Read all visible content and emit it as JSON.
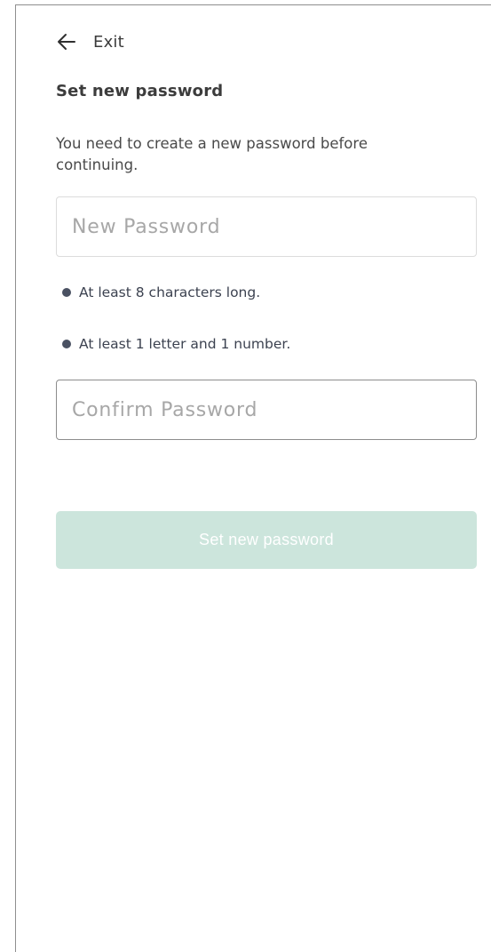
{
  "header": {
    "exit_label": "Exit",
    "back_icon": "arrow-left-icon"
  },
  "main": {
    "title": "Set new password",
    "description": "You need to create a new password before continuing.",
    "new_password": {
      "placeholder": "New Password",
      "value": ""
    },
    "requirements": [
      {
        "label": "At least 8 characters long."
      },
      {
        "label": "At least 1 letter and 1 number."
      }
    ],
    "confirm_password": {
      "placeholder": "Confirm Password",
      "value": ""
    },
    "submit_label": "Set new password",
    "submit_disabled": true
  },
  "colors": {
    "button_disabled_bg": "#cce5dc",
    "text_primary": "#3c3c3c",
    "bullet": "#4a5162"
  }
}
